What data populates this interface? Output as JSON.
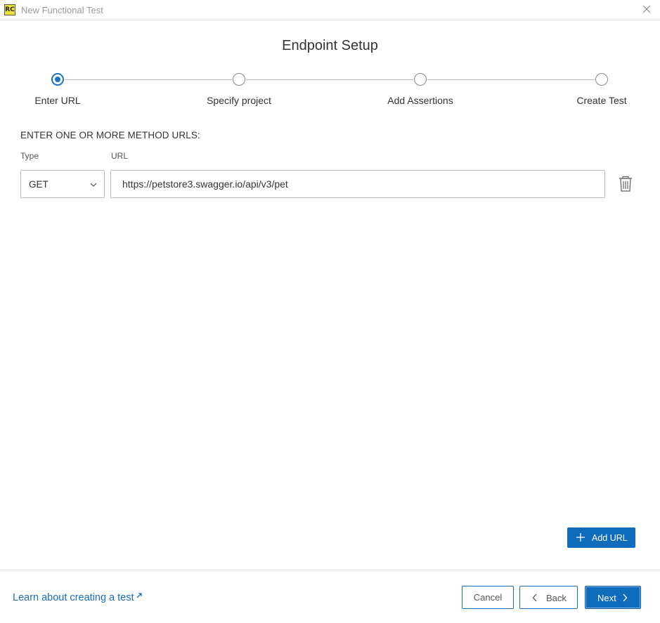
{
  "window": {
    "title": "New Functional Test",
    "app_icon_text": "RC"
  },
  "page": {
    "heading": "Endpoint Setup"
  },
  "stepper": {
    "steps": [
      {
        "label": "Enter URL",
        "active": true
      },
      {
        "label": "Specify project",
        "active": false
      },
      {
        "label": "Add Assertions",
        "active": false
      },
      {
        "label": "Create Test",
        "active": false
      }
    ],
    "active_color": "#1a73c6"
  },
  "form": {
    "section_label": "ENTER ONE OR MORE METHOD URLS:",
    "type_label": "Type",
    "url_label": "URL",
    "rows": [
      {
        "type": "GET",
        "url": "https://petstore3.swagger.io/api/v3/pet"
      }
    ],
    "add_url_label": "Add URL"
  },
  "footer": {
    "learn_link": "Learn about creating a test",
    "cancel_label": "Cancel",
    "back_label": "Back",
    "next_label": "Next"
  },
  "icons": {
    "close": "close-icon",
    "chevron_down": "chevron-down-icon",
    "trash": "trash-icon",
    "plus": "plus-icon",
    "external_link": "external-link-icon",
    "chevron_left": "chevron-left-icon",
    "chevron_right": "chevron-right-icon"
  },
  "colors": {
    "primary": "#0f6cbd",
    "link": "#1a6fb8"
  }
}
